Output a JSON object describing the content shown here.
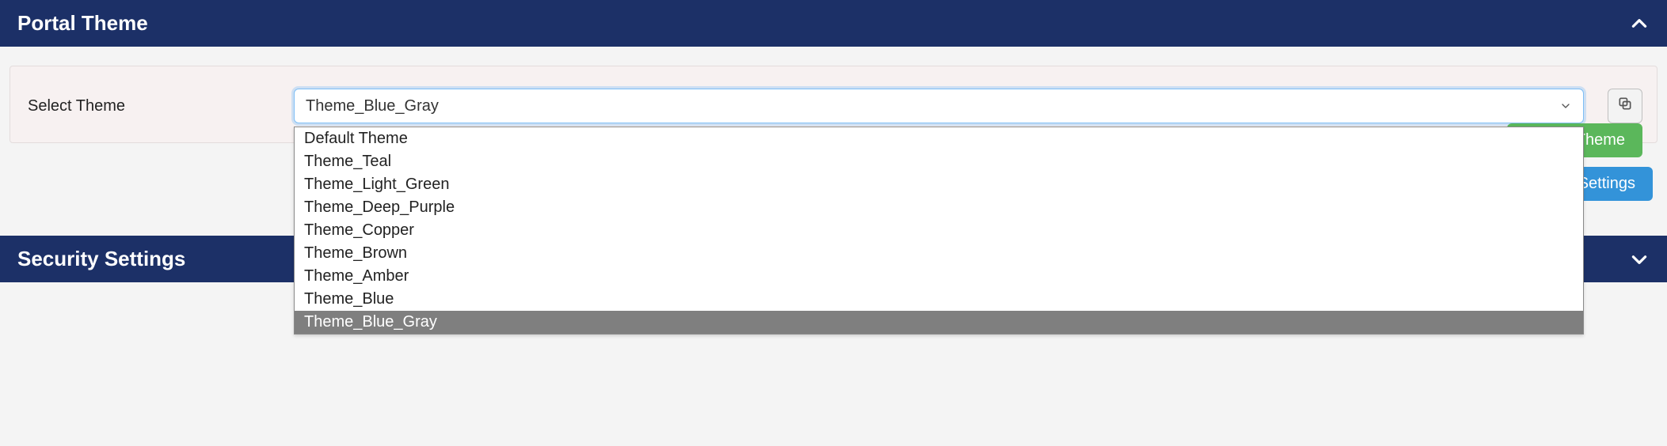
{
  "portal_theme": {
    "title": "Portal Theme",
    "label": "Select Theme",
    "selected": "Theme_Blue_Gray",
    "options": [
      "Default Theme",
      "Theme_Teal",
      "Theme_Light_Green",
      "Theme_Deep_Purple",
      "Theme_Copper",
      "Theme_Brown",
      "Theme_Amber",
      "Theme_Blue",
      "Theme_Blue_Gray"
    ],
    "create_button": "Create Theme"
  },
  "save_button": "Save Settings",
  "security": {
    "title": "Security Settings"
  }
}
